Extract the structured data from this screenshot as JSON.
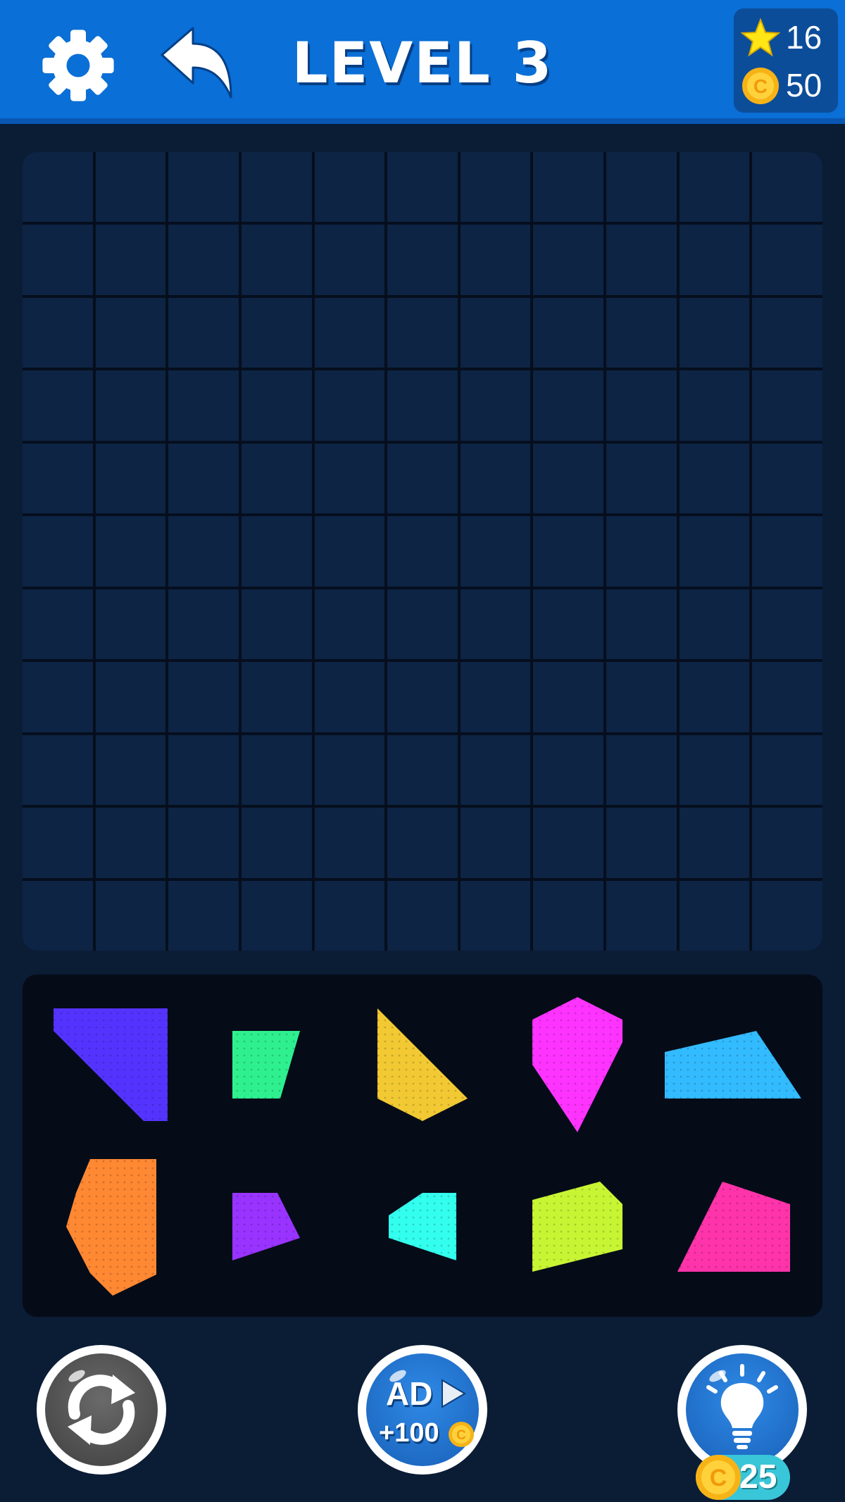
{
  "header": {
    "title": "LEVEL 3",
    "stars": "16",
    "coins": "50",
    "settings_icon": "gear-icon",
    "undo_icon": "undo-arrow-icon",
    "bar_color": "#0a6fd6"
  },
  "board": {
    "columns": 11,
    "rows": 11,
    "cell_color": "#0d2444"
  },
  "tray": {
    "pieces": [
      {
        "name": "blue-violet-piece",
        "color": "#5533ff"
      },
      {
        "name": "green-piece",
        "color": "#2ef08f"
      },
      {
        "name": "yellow-piece",
        "color": "#f2c933"
      },
      {
        "name": "magenta-piece",
        "color": "#ff33ff"
      },
      {
        "name": "sky-blue-piece",
        "color": "#33bbff"
      },
      {
        "name": "orange-piece",
        "color": "#ff8833"
      },
      {
        "name": "purple-piece",
        "color": "#9933ff"
      },
      {
        "name": "cyan-piece",
        "color": "#33ffee"
      },
      {
        "name": "lime-piece",
        "color": "#c8f533"
      },
      {
        "name": "pink-piece",
        "color": "#ff33aa"
      }
    ]
  },
  "footer": {
    "restart_icon": "restart-icon",
    "ad_label": "AD",
    "ad_reward": "+100",
    "hint_icon": "lightbulb-icon",
    "hint_cost": "25"
  }
}
